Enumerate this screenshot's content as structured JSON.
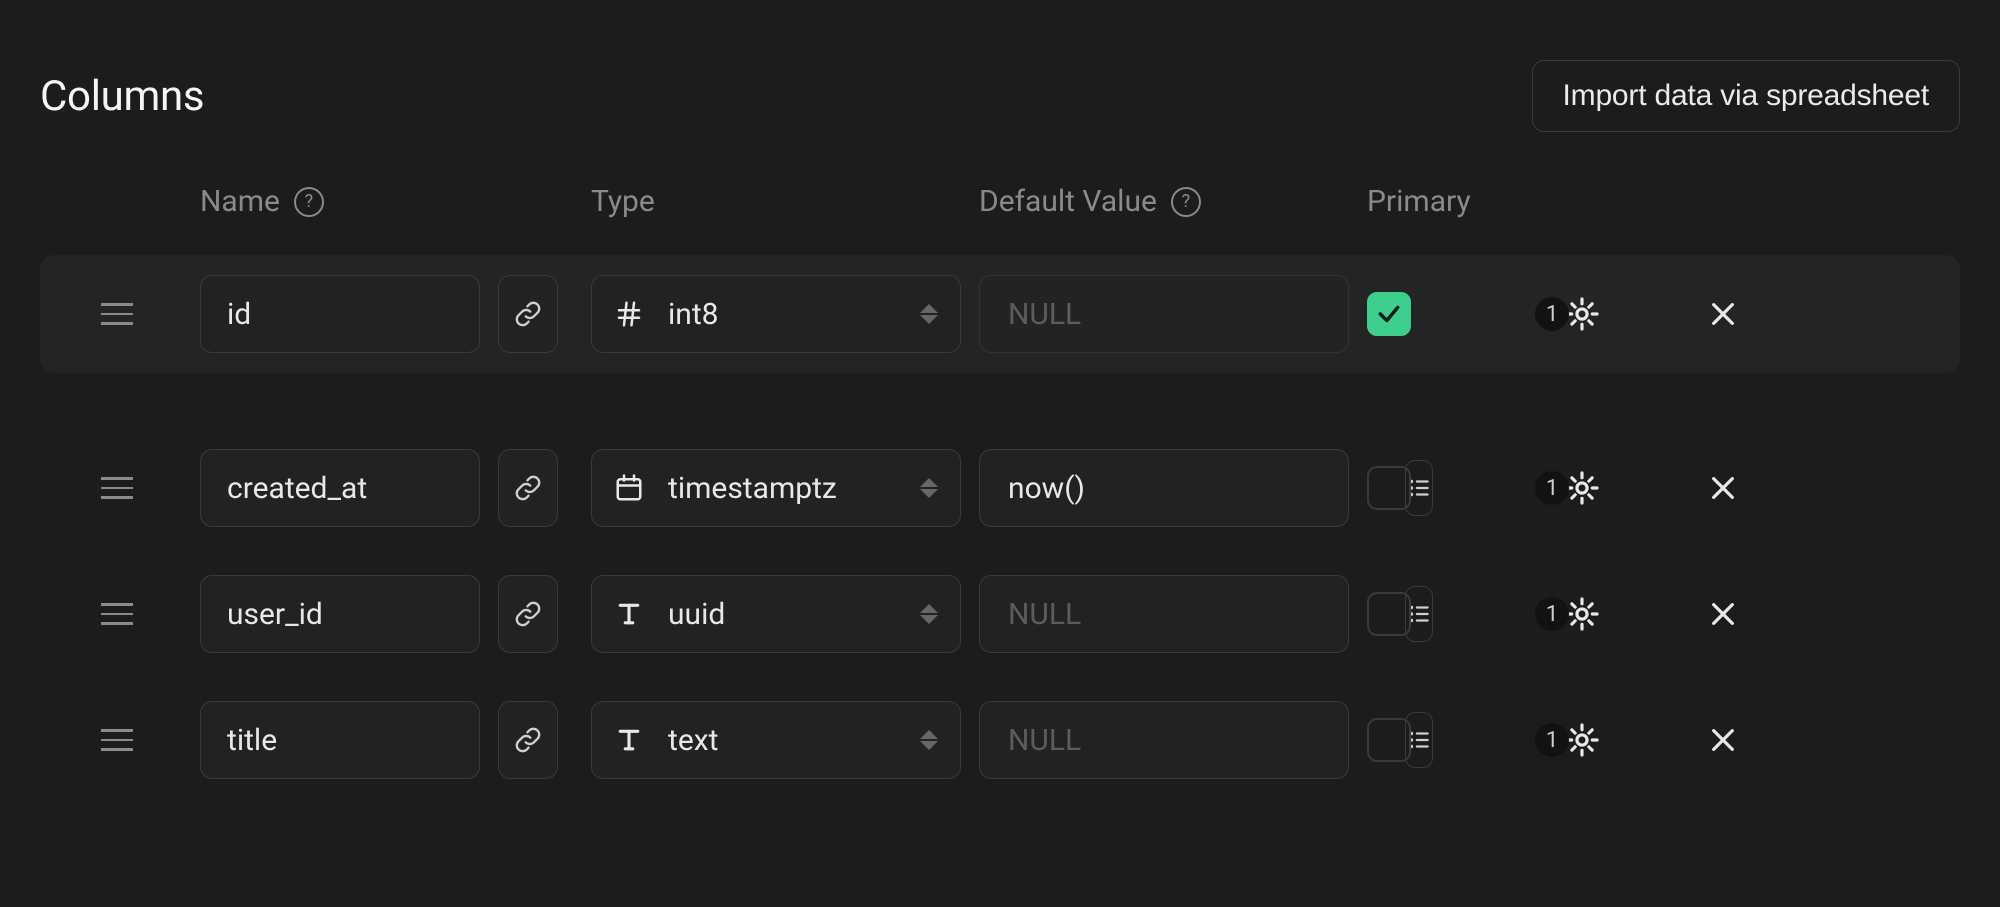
{
  "header": {
    "title": "Columns",
    "import_label": "Import data via spreadsheet"
  },
  "column_headers": {
    "name": "Name",
    "type": "Type",
    "default": "Default Value",
    "primary": "Primary"
  },
  "default_placeholder": "NULL",
  "rows": [
    {
      "name": "id",
      "type_icon": "hash",
      "type": "int8",
      "default_value": "",
      "show_suggest": false,
      "dim_default": true,
      "primary": true,
      "badge": "1"
    },
    {
      "name": "created_at",
      "type_icon": "calendar",
      "type": "timestamptz",
      "default_value": "now()",
      "show_suggest": true,
      "dim_default": false,
      "primary": false,
      "badge": "1"
    },
    {
      "name": "user_id",
      "type_icon": "text",
      "type": "uuid",
      "default_value": "",
      "show_suggest": true,
      "dim_default": false,
      "primary": false,
      "badge": "1"
    },
    {
      "name": "title",
      "type_icon": "text",
      "type": "text",
      "default_value": "",
      "show_suggest": true,
      "dim_default": false,
      "primary": false,
      "badge": "1"
    }
  ]
}
